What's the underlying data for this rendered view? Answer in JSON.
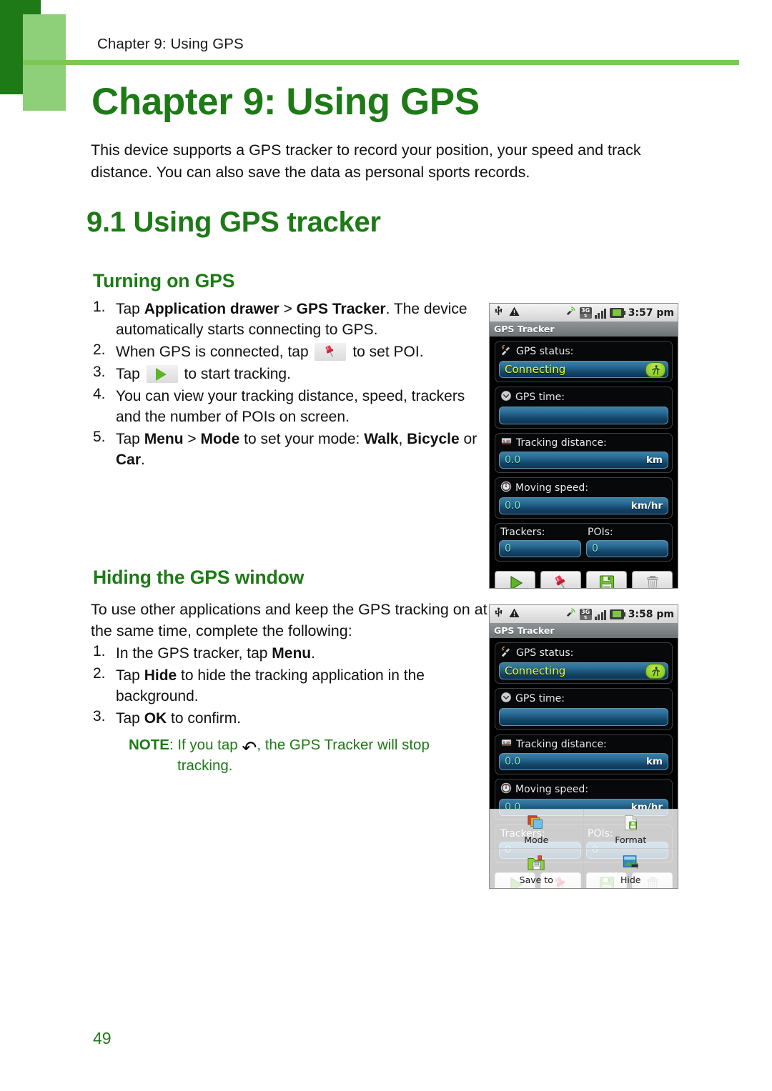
{
  "page": {
    "running_header": "Chapter 9: Using GPS",
    "chapter_title": "Chapter 9: Using GPS",
    "intro": "This device supports a GPS tracker to record your position, your speed and track distance. You can also save the data as personal sports records.",
    "section_title": "9.1 Using GPS tracker",
    "page_number": "49",
    "colors": {
      "heading_green": "#1d7a16",
      "rule_green": "#7dc855",
      "deco_light_green": "#8ed07a"
    }
  },
  "turning_on": {
    "heading": "Turning on GPS",
    "steps": [
      {
        "num": "1.",
        "parts": [
          {
            "t": "Tap "
          },
          {
            "t": "Application drawer",
            "b": true
          },
          {
            "t": " > "
          },
          {
            "t": "GPS Tracker",
            "b": true
          },
          {
            "t": ". The device automatically starts connecting to GPS."
          }
        ]
      },
      {
        "num": "2.",
        "parts": [
          {
            "t": "When GPS is connected, tap "
          },
          {
            "icon": "pushpin-chip"
          },
          {
            "t": " to set POI."
          }
        ]
      },
      {
        "num": "3.",
        "parts": [
          {
            "t": "Tap "
          },
          {
            "icon": "play-chip"
          },
          {
            "t": " to start tracking."
          }
        ]
      },
      {
        "num": "4.",
        "parts": [
          {
            "t": "You can view your tracking distance, speed, trackers and the number of POIs on screen."
          }
        ]
      },
      {
        "num": "5.",
        "parts": [
          {
            "t": "Tap "
          },
          {
            "t": "Menu",
            "b": true
          },
          {
            "t": " > "
          },
          {
            "t": "Mode",
            "b": true
          },
          {
            "t": " to set your mode: "
          },
          {
            "t": "Walk",
            "b": true
          },
          {
            "t": ", "
          },
          {
            "t": "Bicycle",
            "b": true
          },
          {
            "t": " or "
          },
          {
            "t": "Car",
            "b": true
          },
          {
            "t": "."
          }
        ]
      }
    ]
  },
  "hiding": {
    "heading": "Hiding the GPS window",
    "paragraph": "To use other applications and keep the GPS tracking on at the same time, complete the following:",
    "steps": [
      {
        "num": "1.",
        "parts": [
          {
            "t": "In the GPS tracker, tap "
          },
          {
            "t": "Menu",
            "b": true
          },
          {
            "t": "."
          }
        ]
      },
      {
        "num": "2.",
        "parts": [
          {
            "t": "Tap "
          },
          {
            "t": "Hide",
            "b": true
          },
          {
            "t": " to hide the tracking application in the background."
          }
        ]
      },
      {
        "num": "3.",
        "parts": [
          {
            "t": "Tap "
          },
          {
            "t": "OK",
            "b": true
          },
          {
            "t": " to confirm."
          }
        ]
      }
    ],
    "note": {
      "label": "NOTE",
      "before": ": If you tap ",
      "icon": "back-arrow-icon",
      "after": ", the GPS Tracker will stop",
      "indent": "tracking."
    }
  },
  "screenshot1": {
    "statusbar": {
      "icons_left": [
        "usb-icon",
        "warning-icon"
      ],
      "icons_right": [
        "gps-signal-icon",
        "3g-icon",
        "signal-bars-icon",
        "battery-icon"
      ],
      "time": "3:57 pm"
    },
    "app_title": "GPS Tracker",
    "fields": [
      {
        "icon": "satellite-icon",
        "label": "GPS status:",
        "value": "Connecting",
        "unit": "",
        "badge": "walking-icon"
      },
      {
        "icon": "clock-icon",
        "label": "GPS time:",
        "value": "",
        "unit": ""
      },
      {
        "icon": "odometer-icon",
        "label": "Tracking distance:",
        "value": "0.0",
        "unit": "km"
      },
      {
        "icon": "speedometer-icon",
        "label": "Moving speed:",
        "value": "0.0",
        "unit": "km/hr"
      }
    ],
    "counters": [
      {
        "label": "Trackers:",
        "value": "0"
      },
      {
        "label": "POIs:",
        "value": "0"
      }
    ],
    "buttons": [
      "play-icon",
      "pushpin-icon",
      "save-icon",
      "trash-icon"
    ]
  },
  "screenshot2": {
    "statusbar": {
      "icons_left": [
        "usb-icon",
        "warning-icon"
      ],
      "icons_right": [
        "gps-signal-icon",
        "3g-icon",
        "signal-bars-icon",
        "battery-icon"
      ],
      "time": "3:58 pm"
    },
    "app_title": "GPS Tracker",
    "fields": [
      {
        "icon": "satellite-icon",
        "label": "GPS status:",
        "value": "Connecting",
        "unit": "",
        "badge": "walking-icon"
      },
      {
        "icon": "clock-icon",
        "label": "GPS time:",
        "value": "",
        "unit": ""
      },
      {
        "icon": "odometer-icon",
        "label": "Tracking distance:",
        "value": "0.0",
        "unit": "km"
      },
      {
        "icon": "speedometer-icon",
        "label": "Moving speed:",
        "value": "0.0",
        "unit": "km/hr"
      }
    ],
    "counters": [
      {
        "label": "Trackers:",
        "value": "0"
      },
      {
        "label": "POIs:",
        "value": "0"
      }
    ],
    "menu": [
      {
        "label": "Mode",
        "icon": "layers-icon"
      },
      {
        "label": "Format",
        "icon": "document-save-icon"
      },
      {
        "label": "Save to",
        "icon": "folder-save-icon"
      },
      {
        "label": "Hide",
        "icon": "hide-window-icon"
      }
    ]
  }
}
